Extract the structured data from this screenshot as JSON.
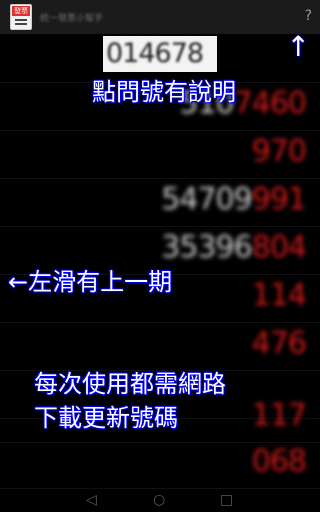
{
  "action_bar": {
    "app_icon_label": "發票",
    "title": "統一發票小幫手",
    "help": "?"
  },
  "rows": [
    {
      "white": "014678",
      "red": "",
      "highlight": true
    },
    {
      "white": "510",
      "red": "7460",
      "highlight": false
    },
    {
      "white": "",
      "red": "970",
      "highlight": false
    },
    {
      "white": "54709",
      "red": "991",
      "highlight": false
    },
    {
      "white": "35396",
      "red": "804",
      "highlight": false
    },
    {
      "white": "",
      "red": "114",
      "highlight": false
    },
    {
      "white": "",
      "red": "476",
      "highlight": false
    },
    {
      "white": "",
      "red": "",
      "highlight": false
    },
    {
      "white": "",
      "red": "117",
      "highlight": false
    },
    {
      "white": "",
      "red": "068",
      "highlight": false
    }
  ],
  "overlay": {
    "arrow_up": "↑",
    "help_hint": "點問號有說明",
    "swipe_hint": "←左滑有上一期",
    "network_hint_1": "每次使用都需網路",
    "network_hint_2": "下載更新號碼"
  },
  "nav": {
    "back": "◁",
    "home": "○",
    "recents": "□"
  }
}
